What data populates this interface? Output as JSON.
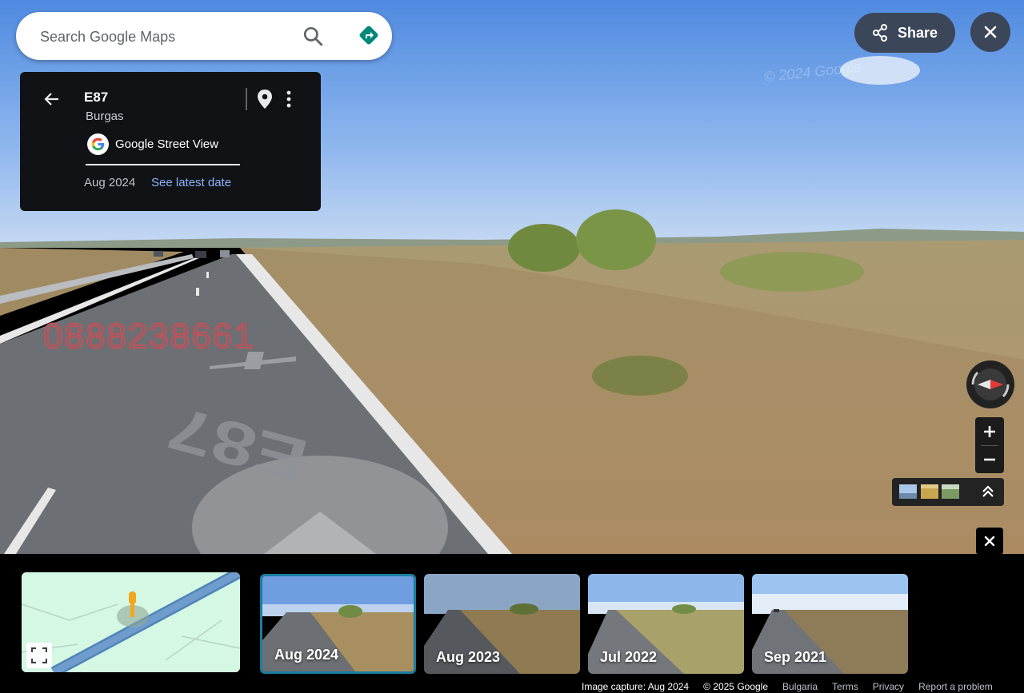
{
  "search": {
    "placeholder": "Search Google Maps"
  },
  "card": {
    "title": "E87",
    "subtitle": "Burgas",
    "source": "Google Street View",
    "date": "Aug 2024",
    "latest_link": "See latest date"
  },
  "share": {
    "label": "Share"
  },
  "scene": {
    "watermark_number": "0888238661",
    "road_marking": "E87",
    "copyright_watermark": "© 2024 Google"
  },
  "filmstrip": {
    "thumbnails": [
      {
        "label": "Aug 2024",
        "selected": true
      },
      {
        "label": "Aug 2023",
        "selected": false
      },
      {
        "label": "Jul 2022",
        "selected": false
      },
      {
        "label": "Sep 2021",
        "selected": false
      }
    ]
  },
  "footer": {
    "capture": "Image capture: Aug 2024",
    "copyright": "© 2025 Google",
    "country": "Bulgaria",
    "terms": "Terms",
    "privacy": "Privacy",
    "report": "Report a problem"
  },
  "colors": {
    "accent_teal": "#00897b",
    "card_bg": "#101216",
    "link_blue": "#8ab4f8",
    "selected_border": "#1a7fa0"
  },
  "icons": [
    "search-icon",
    "directions-icon",
    "back-arrow-icon",
    "pin-icon",
    "more-vert-icon",
    "share-icon",
    "close-icon",
    "compass-icon",
    "plus-icon",
    "minus-icon",
    "chevron-up-icon",
    "expand-icon",
    "google-logo-icon"
  ]
}
